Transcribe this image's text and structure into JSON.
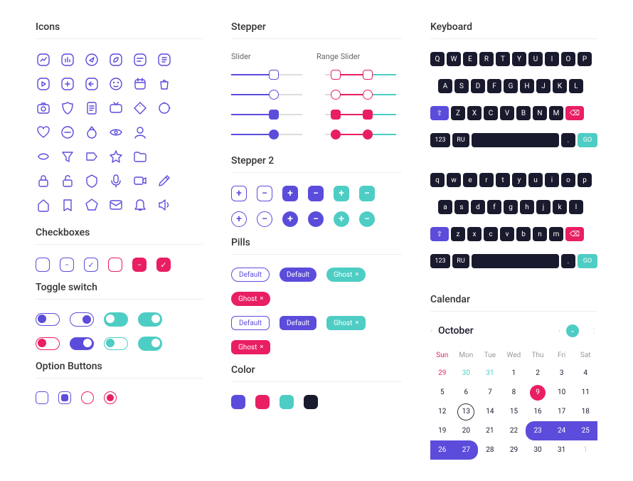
{
  "sections": {
    "icons": "Icons",
    "checkboxes": "Checkboxes",
    "toggle": "Toggle switch",
    "option": "Option Buttons",
    "stepper": "Stepper",
    "stepper2": "Stepper 2",
    "pills": "Pills",
    "color": "Color",
    "keyboard": "Keyboard",
    "calendar": "Calendar"
  },
  "stepper": {
    "slider_label": "Slider",
    "range_label": "Range Slider"
  },
  "pills": {
    "default": "Default",
    "ghost": "Ghost"
  },
  "colors": {
    "indigo": "#5b4cdb",
    "pink": "#e91e63",
    "teal": "#4ecdc4",
    "dark": "#1a1a2e"
  },
  "keyboard": {
    "upper_num": "123",
    "lang": "RU",
    "go": "GO",
    "dot": ".",
    "rows_upper": [
      [
        "Q",
        "W",
        "E",
        "R",
        "T",
        "Y",
        "U",
        "I",
        "O",
        "P"
      ],
      [
        "A",
        "S",
        "D",
        "F",
        "G",
        "H",
        "J",
        "K",
        "L"
      ],
      [
        "Z",
        "X",
        "C",
        "V",
        "B",
        "N",
        "M"
      ]
    ],
    "rows_lower": [
      [
        "q",
        "w",
        "e",
        "r",
        "t",
        "y",
        "u",
        "i",
        "o",
        "p"
      ],
      [
        "a",
        "s",
        "d",
        "f",
        "g",
        "h",
        "j",
        "k",
        "l"
      ],
      [
        "z",
        "x",
        "c",
        "v",
        "b",
        "n",
        "m"
      ]
    ]
  },
  "calendar": {
    "month": "October",
    "dow": [
      "Sun",
      "Mon",
      "Tue",
      "Wed",
      "Thu",
      "Fri",
      "Sat"
    ],
    "prev_tail": [
      29,
      30,
      31
    ],
    "days": [
      1,
      2,
      3,
      4,
      5,
      6,
      7,
      8,
      9,
      10,
      11,
      12,
      13,
      14,
      15,
      16,
      17,
      18,
      19,
      20,
      21,
      22,
      23,
      24,
      25,
      26,
      27,
      28,
      29,
      30,
      31
    ],
    "next_head": [
      1
    ],
    "selected_pink": 9,
    "today_ring": 13,
    "range_start": 23,
    "range_end": 27
  },
  "icons": [
    "chart-icon",
    "bar-chart-icon",
    "compass-icon",
    "leaf-icon",
    "chat-icon",
    "note-icon",
    "play-icon",
    "plus-square-icon",
    "exit-icon",
    "face-icon",
    "calendar-icon",
    "bag-icon",
    "camera-icon",
    "shield-icon",
    "document-icon",
    "tv-icon",
    "tag-icon",
    "loop-icon",
    "heart-icon",
    "circle-minus-icon",
    "ring-icon",
    "eye-icon",
    "user-icon",
    "blank-icon",
    "mouth-icon",
    "funnel-icon",
    "label-icon",
    "star-icon",
    "folder-icon",
    "blank2-icon",
    "lock-icon",
    "unlock-icon",
    "badge-icon",
    "mic-icon",
    "video-icon",
    "pencil-icon",
    "home-icon",
    "bookmark-icon",
    "pentagon-icon",
    "mail-icon",
    "bell-icon",
    "speaker-icon"
  ]
}
